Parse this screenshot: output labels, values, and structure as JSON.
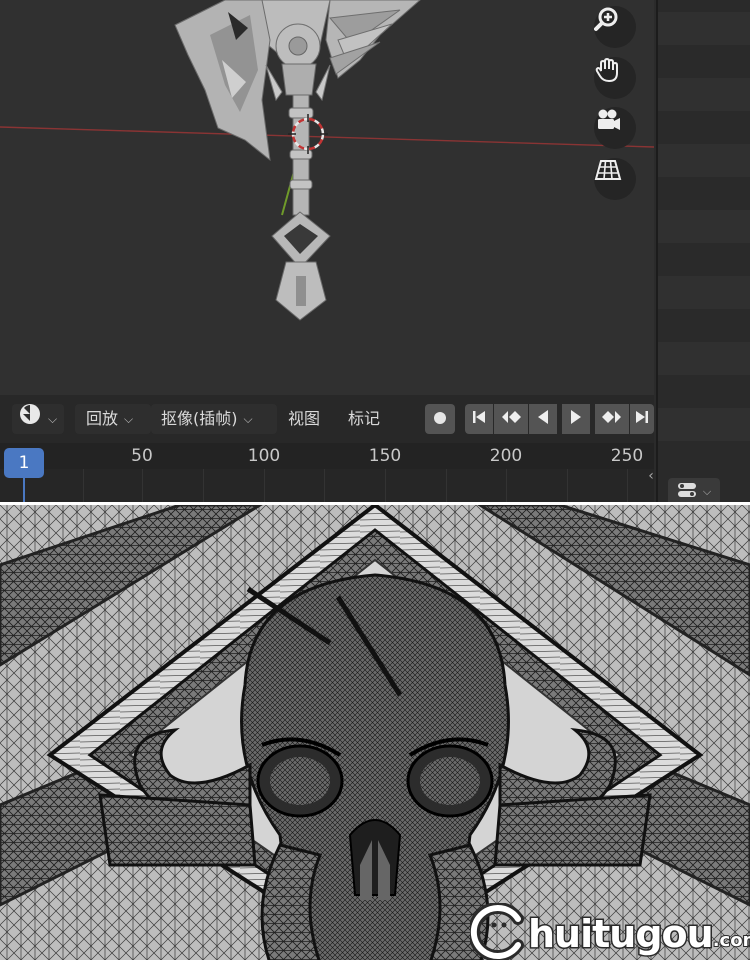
{
  "timeline_header": {
    "editor_type_icon": "clock-icon",
    "menus": [
      "回放",
      "抠像(插帧)",
      "视图",
      "标记"
    ],
    "record_icon": "record-dot-icon",
    "playback_icons": [
      "jump-start-icon",
      "prev-keyframe-icon",
      "play-reverse-icon",
      "play-icon",
      "next-keyframe-icon",
      "jump-end-icon"
    ]
  },
  "frame_ruler": {
    "current_frame": "1",
    "tick_labels": [
      "50",
      "100",
      "150",
      "200",
      "250"
    ]
  },
  "viewport_gizmos": [
    "zoom-icon",
    "hand-pan-icon",
    "camera-icon",
    "grid-perspective-icon"
  ],
  "colors": {
    "accent": "#4a78c2",
    "x_axis": "#9a3b3b",
    "y_axis": "#6f9a2a"
  },
  "watermark": {
    "text": "huitugou",
    "suffix": ".com"
  }
}
